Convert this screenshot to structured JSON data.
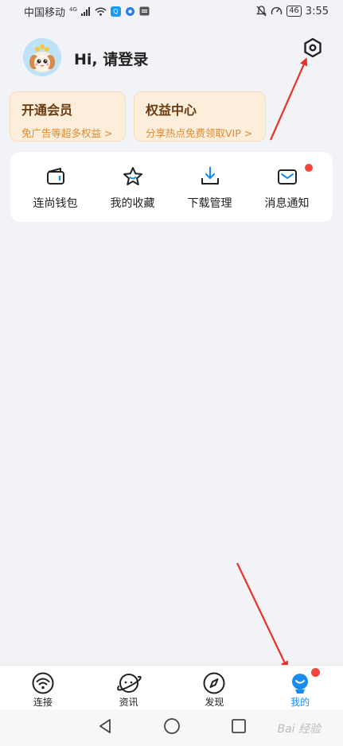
{
  "status_bar": {
    "carrier": "中国移动",
    "network": "4G",
    "battery": "46",
    "time": "3:55"
  },
  "profile": {
    "greeting": "Hi, 请登录"
  },
  "promos": [
    {
      "title": "开通会员",
      "subtitle": "免广告等超多权益 >"
    },
    {
      "title": "权益中心",
      "subtitle": "分享热点免费领取VIP >"
    }
  ],
  "quick_actions": [
    {
      "label": "连尚钱包",
      "icon": "wallet-icon"
    },
    {
      "label": "我的收藏",
      "icon": "star-icon"
    },
    {
      "label": "下载管理",
      "icon": "download-icon"
    },
    {
      "label": "消息通知",
      "icon": "mail-icon",
      "badge": true
    }
  ],
  "tabs": [
    {
      "label": "连接",
      "icon": "wifi-icon"
    },
    {
      "label": "资讯",
      "icon": "planet-icon"
    },
    {
      "label": "发现",
      "icon": "compass-icon"
    },
    {
      "label": "我的",
      "icon": "profile-icon",
      "active": true,
      "badge": true
    }
  ],
  "watermark": "Bai 经验",
  "colors": {
    "accent": "#1a8cf0",
    "badge": "#f5443b",
    "annotation_arrow": "#e8322a",
    "promo_bg": "#fdeedb",
    "promo_subtitle": "#e08a2e"
  }
}
